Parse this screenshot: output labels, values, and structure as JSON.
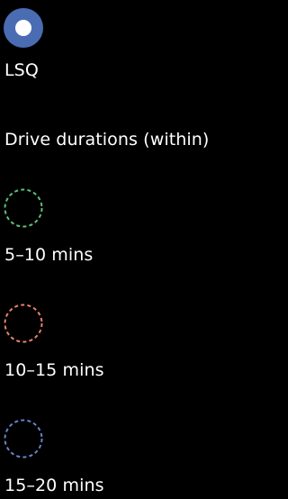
{
  "origin": {
    "label": "LSQ",
    "icon": "origin-marker-icon",
    "color": "#4a6cb3"
  },
  "legend": {
    "title": "Drive durations (within)",
    "items": [
      {
        "label": "5–10 mins",
        "color": "#5fbf7a",
        "icon": "dashed-circle-icon"
      },
      {
        "label": "10–15 mins",
        "color": "#e8826b",
        "icon": "dashed-circle-icon"
      },
      {
        "label": "15–20 mins",
        "color": "#6b82c8",
        "icon": "dashed-circle-icon"
      }
    ]
  }
}
